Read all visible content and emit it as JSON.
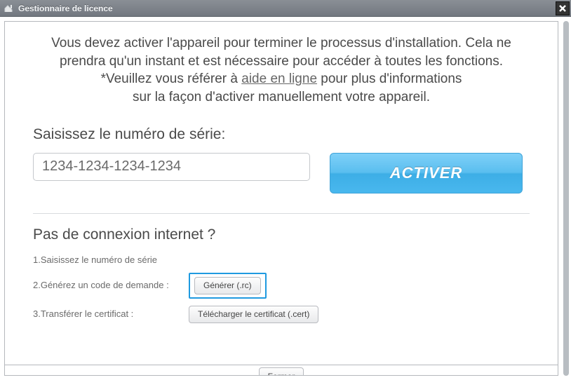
{
  "window": {
    "title": "Gestionnaire de licence"
  },
  "intro": {
    "line1": "Vous devez activer l'appareil pour terminer le processus d'installation. Cela ne prendra qu'un instant et est nécessaire pour accéder à toutes les fonctions.",
    "line2_prefix": "*Veuillez vous référer à ",
    "line2_link": "aide en ligne",
    "line2_mid": " pour plus d'informations",
    "line3": "sur la façon d'activer manuellement votre appareil."
  },
  "serial": {
    "label": "Saisissez le numéro de série:",
    "value": "1234-1234-1234-1234",
    "activate": "ACTIVER"
  },
  "offline": {
    "heading": "Pas de connexion internet ?",
    "step1": "1.Saisissez le numéro de série",
    "step2": "2.Générez un code de demande :",
    "step3": "3.Transférer le certificat :",
    "generate_btn": "Générer (.rc)",
    "upload_btn": "Télécharger le certificat (.cert)"
  },
  "footer": {
    "close": "Fermer"
  }
}
